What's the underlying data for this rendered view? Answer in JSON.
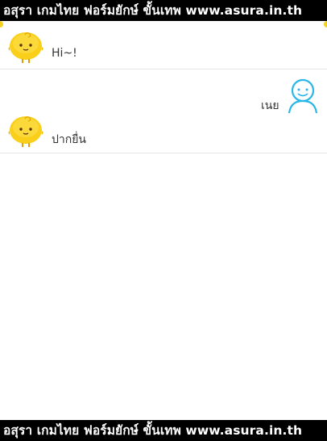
{
  "banner": {
    "top_text": "อสุรา เกมไทย ฟอร์มยักษ์ ขั้นเทพ www.asura.in.th",
    "bottom_text": "อสุรา เกมไทย ฟอร์มยักษ์ ขั้นเทพ www.asura.in.th"
  },
  "messages": [
    {
      "sender": "bot",
      "avatar": "yellow-chick-icon",
      "text": "Hi~!"
    },
    {
      "sender": "user",
      "avatar": "blue-person-icon",
      "text": "เนย"
    },
    {
      "sender": "bot",
      "avatar": "yellow-chick-icon",
      "text": "ปากยื่น"
    }
  ],
  "colors": {
    "banner_bg": "#000000",
    "banner_text": "#ffffff",
    "chick_yellow": "#f9cf1a",
    "user_avatar_blue": "#29b6e8",
    "divider": "#e6e6e6"
  }
}
